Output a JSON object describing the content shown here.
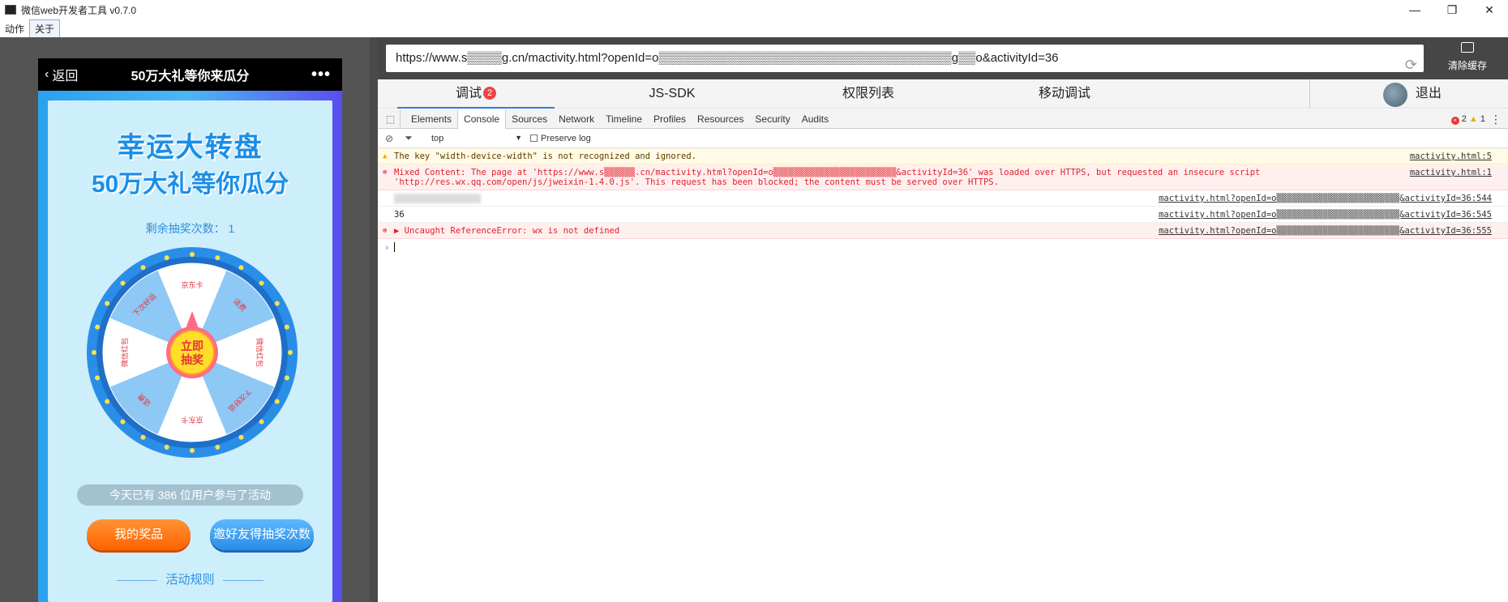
{
  "window": {
    "title": "微信web开发者工具 v0.7.0",
    "min": "—",
    "max": "❐",
    "close": "✕"
  },
  "menu": [
    "动作",
    "关于"
  ],
  "phone": {
    "nav_back": "返回",
    "nav_title": "50万大礼等你来瓜分",
    "nav_more": "•••",
    "headline1": "幸运大转盘",
    "headline2": "50万大礼等你瓜分",
    "remain": "剩余抽奖次数： 1",
    "center_button": [
      "立即",
      "抽奖"
    ],
    "wheel_labels": [
      "京东卡",
      "话费",
      "微信红包",
      "下次好运",
      "京东卡",
      "话费",
      "微信红包",
      "下次好运"
    ],
    "count_text": "今天已有  386  位用户参与了活动",
    "btn_prize": "我的奖品",
    "btn_invite": "邀好友得抽奖次数",
    "rules": "活动规则"
  },
  "url": {
    "text": "https://www.s▒▒▒▒g.cn/mactivity.html?openId=o▒▒▒▒▒▒▒▒▒▒▒▒▒▒▒▒▒▒▒▒▒▒▒▒▒▒▒▒▒▒▒▒▒▒g▒▒o&activityId=36",
    "clear_cache": "清除缓存"
  },
  "tabs": {
    "debug": "调试",
    "debug_badge": "2",
    "jssdk": "JS-SDK",
    "perm": "权限列表",
    "mobile": "移动调试",
    "logout": "退出"
  },
  "devtools": {
    "tabs": [
      "Elements",
      "Console",
      "Sources",
      "Network",
      "Timeline",
      "Profiles",
      "Resources",
      "Security",
      "Audits"
    ],
    "err_count": "2",
    "warn_count": "1",
    "context": "top",
    "preserve_log": "Preserve log"
  },
  "console": {
    "warn_msg": "The key \"width-device-width\" is not recognized and ignored.",
    "warn_src": "mactivity.html:5",
    "mixed_msg1": "Mixed Content: The page at 'https://www.s▒▒▒▒▒▒.cn/mactivity.html?openId=o▒▒▒▒▒▒▒▒▒▒▒▒▒▒▒▒▒▒▒▒▒▒▒▒&activityId=36' was loaded over HTTPS, but requested an insecure script",
    "mixed_msg2": "'http://res.wx.qq.com/open/js/jweixin-1.4.0.js'. This request has been blocked; the content must be served over HTTPS.",
    "mixed_src": "mactivity.html:1",
    "log1_msg": "▒▒▒▒▒▒▒▒▒▒▒▒▒▒▒▒▒",
    "log1_src": "mactivity.html?openId=o▒▒▒▒▒▒▒▒▒▒▒▒▒▒▒▒▒▒▒▒▒▒▒▒&activityId=36:544",
    "log2_msg": "36",
    "log2_src": "mactivity.html?openId=o▒▒▒▒▒▒▒▒▒▒▒▒▒▒▒▒▒▒▒▒▒▒▒▒&activityId=36:545",
    "err_msg": "Uncaught ReferenceError: wx is not defined",
    "err_src": "mactivity.html?openId=o▒▒▒▒▒▒▒▒▒▒▒▒▒▒▒▒▒▒▒▒▒▒▒▒&activityId=36:555",
    "prompt": "›"
  }
}
